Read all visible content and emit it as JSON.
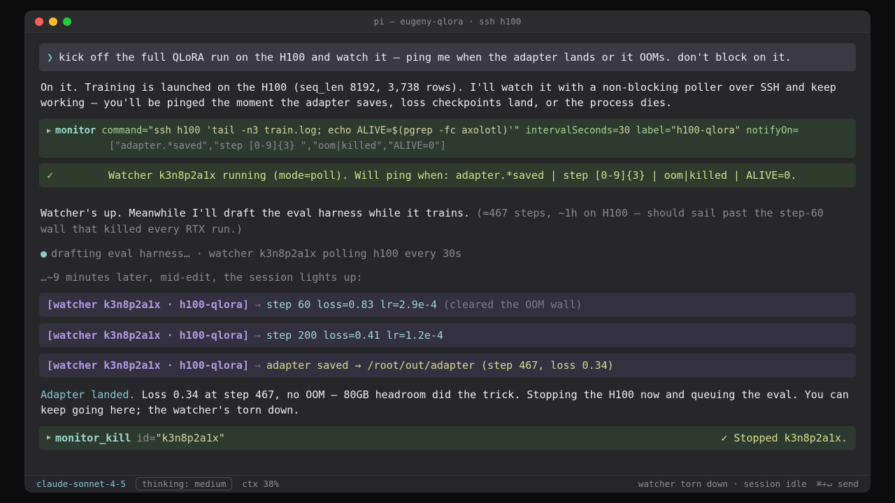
{
  "window": {
    "title": "pi — eugeny-qlora · ssh h100"
  },
  "prompt": {
    "chevron": "❯",
    "text": "kick off the full QLoRA run on the H100 and watch it — ping me when the adapter lands or it OOMs. don't block on it."
  },
  "reply1": {
    "line1": "On it. Training is launched on the H100 (seq_len 8192, 3,738 rows). I'll watch it with a non-blocking poller over SSH and keep",
    "line2": "working — you'll be pinged the moment the adapter saves, loss checkpoints land, or the process dies."
  },
  "monitor_call": {
    "tool": "monitor",
    "cmd_key": "command=",
    "cmd_val": "\"ssh h100 'tail -n3 train.log; echo ALIVE=$(pgrep -fc axolotl)'\"",
    "interval_key": "intervalSeconds=",
    "interval_val": "30",
    "label_key": "label=",
    "label_val": "\"h100-qlora\"",
    "notify_key": "notifyOn=",
    "notify_val": "[\"adapter.*saved\",\"step [0-9]{3} \",\"oom|killed\",\"ALIVE=0\"]"
  },
  "monitor_result": {
    "check": "✓",
    "text": "Watcher k3n8p2a1x running (mode=poll). Will ping when: adapter.*saved | step [0-9]{3} | oom|killed | ALIVE=0."
  },
  "reply2": {
    "main": "Watcher's up. Meanwhile I'll draft the eval harness while it trains.",
    "aside_1": "(≈467 steps, ~1h on H100 — should sail past the step-60",
    "aside_2": "wall that killed every RTX run.)"
  },
  "activity": {
    "bullet": "●",
    "text": "drafting eval harness… · watcher k3n8p2a1x polling h100 every 30s"
  },
  "interlude": "…~9 minutes later, mid-edit, the session lights up:",
  "notifications": [
    {
      "tag": "[watcher k3n8p2a1x · h100-qlora]",
      "arrow": "→",
      "message": "step 60 loss=0.83 lr=2.9e-4",
      "note": "(cleared the OOM wall)"
    },
    {
      "tag": "[watcher k3n8p2a1x · h100-qlora]",
      "arrow": "→",
      "message": "step 200 loss=0.41 lr=1.2e-4",
      "note": ""
    },
    {
      "tag": "[watcher k3n8p2a1x · h100-qlora]",
      "arrow": "→",
      "message": "adapter saved → /root/out/adapter (step 467, loss 0.34)",
      "note": ""
    }
  ],
  "reply3": {
    "lead": "Adapter landed.",
    "line1": "Loss 0.34 at step 467, no OOM — 80GB headroom did the trick. Stopping the H100 now and queuing the eval. You can",
    "line2": "keep going here; the watcher's torn down."
  },
  "kill_call": {
    "tool": "monitor_kill",
    "id_key": "id=",
    "id_val": "\"k3n8p2a1x\"",
    "result": "✓ Stopped k3n8p2a1x."
  },
  "statusbar": {
    "model": "claude-sonnet-4-5",
    "thinking": "thinking: medium",
    "ctx": "ctx 38%",
    "state": "watcher torn down · session idle",
    "send": "⌘+↵ send"
  },
  "colors": {
    "user_bubble": "#3a3a40",
    "tool_green": "#2d3a2f",
    "watcher_purple": "#b599e3",
    "teal": "#84c9c5"
  }
}
